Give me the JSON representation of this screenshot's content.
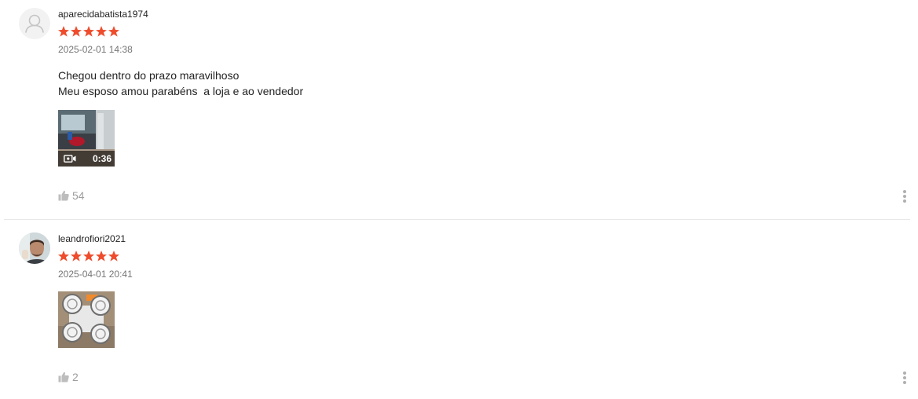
{
  "colors": {
    "star": "#ee4d2d",
    "muted_text": "#757575",
    "like_icon": "#bdbdbd"
  },
  "reviews": [
    {
      "username": "aparecidabatista1974",
      "rating": 5,
      "date": "2025-02-01 14:38",
      "text_lines": [
        "Chegou dentro do prazo maravilhoso",
        "Meu esposo amou parabéns  a loja e ao vendedor"
      ],
      "media": {
        "type": "video",
        "duration": "0:36",
        "icon": "video-camera-icon"
      },
      "likes": "54"
    },
    {
      "username": "leandrofiori2021",
      "rating": 5,
      "date": "2025-04-01 20:41",
      "text_lines": [],
      "media": {
        "type": "image",
        "icon": "photo-thumbnail"
      },
      "likes": "2"
    }
  ]
}
